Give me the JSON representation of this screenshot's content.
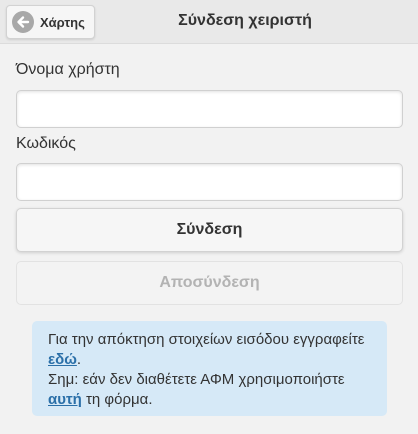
{
  "header": {
    "back_label": "Χάρτης",
    "title": "Σύνδεση χειριστή"
  },
  "form": {
    "username_label": "Όνομα χρήστη",
    "username_value": "",
    "password_label": "Κωδικός",
    "password_value": "",
    "login_button": "Σύνδεση",
    "logout_button": "Αποσύνδεση"
  },
  "info": {
    "line1": "Για την απόκτηση στοιχείων εισόδου εγγραφείτε ",
    "link1": "εδώ",
    "after_link1": ".",
    "line2": "Σημ: εάν δεν διαθέτετε ΑΦΜ χρησιμοποιήστε ",
    "link2": "αυτή",
    "after_link2": " τη φόρμα."
  },
  "icons": {
    "back": "arrow-left-circle-icon"
  },
  "colors": {
    "background": "#f2f2f2",
    "info_background": "#d6e9f7",
    "link": "#2a6fa8",
    "disabled_text": "#b3b3b3"
  }
}
